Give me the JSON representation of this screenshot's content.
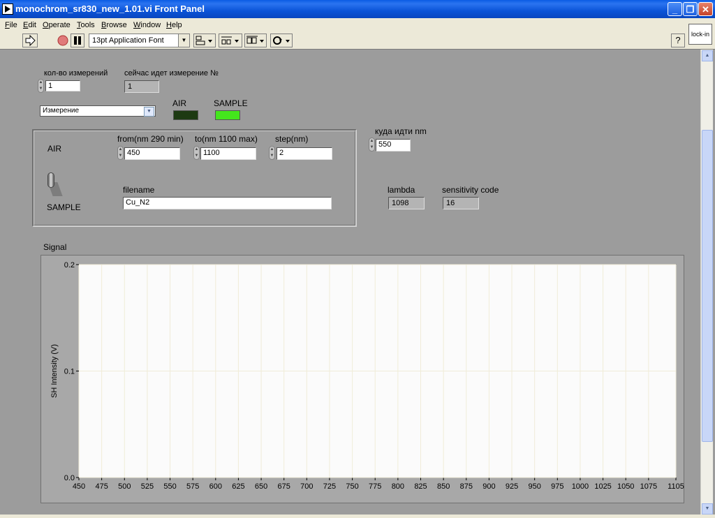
{
  "window": {
    "title": "monochrom_sr830_new_1.01.vi Front Panel",
    "buttons": [
      "_",
      "❐",
      "✕"
    ]
  },
  "menu": {
    "items": [
      {
        "label": "File",
        "mnemonic": "F",
        "rest": "ile"
      },
      {
        "label": "Edit",
        "mnemonic": "E",
        "rest": "dit"
      },
      {
        "label": "Operate",
        "mnemonic": "O",
        "rest": "perate"
      },
      {
        "label": "Tools",
        "mnemonic": "T",
        "rest": "ools"
      },
      {
        "label": "Browse",
        "mnemonic": "B",
        "rest": "rowse"
      },
      {
        "label": "Window",
        "mnemonic": "W",
        "rest": "indow"
      },
      {
        "label": "Help",
        "mnemonic": "H",
        "rest": "elp"
      }
    ]
  },
  "toolbar": {
    "font": "13pt Application Font",
    "help_icon": "?",
    "vi_icon": "lock-in"
  },
  "controls": {
    "count_label": "кол-во измерений",
    "count_value": "1",
    "current_label": "сейчас идет измерение №",
    "current_value": "1",
    "mode_value": "Измерение",
    "led_air_label": "AIR",
    "led_sample_label": "SAMPLE",
    "air_label": "AIR",
    "sample_label": "SAMPLE",
    "from_label": "from(nm 290 min)",
    "from_value": "450",
    "to_label": "to(nm 1100 max)",
    "to_value": "1100",
    "step_label": "step(nm)",
    "step_value": "2",
    "filename_label": "filename",
    "filename_value": "Cu_N2",
    "goto_label": "куда идти nm",
    "goto_value": "550",
    "lambda_label": "lambda",
    "lambda_value": "1098",
    "sens_label": "sensitivity code",
    "sens_value": "16"
  },
  "colors": {
    "led_air": "#1d3a12",
    "led_sample": "#44e61c",
    "plot_bg": "#fbfbfb",
    "grid": "#f0ecd8"
  },
  "chart_data": {
    "type": "line",
    "title": "Signal",
    "xlabel": "",
    "ylabel": "SH Intensity (V)",
    "xlim": [
      450,
      1105
    ],
    "ylim": [
      0,
      0.2
    ],
    "xticks": [
      450,
      475,
      500,
      525,
      550,
      575,
      600,
      625,
      650,
      675,
      700,
      725,
      750,
      775,
      800,
      825,
      850,
      875,
      900,
      925,
      950,
      975,
      1000,
      1025,
      1050,
      1075,
      1105
    ],
    "yticks": [
      0.0,
      0.1,
      0.2
    ],
    "ytick_labels": [
      "0.0",
      "0.1",
      "0.2"
    ],
    "grid": true,
    "series": []
  }
}
